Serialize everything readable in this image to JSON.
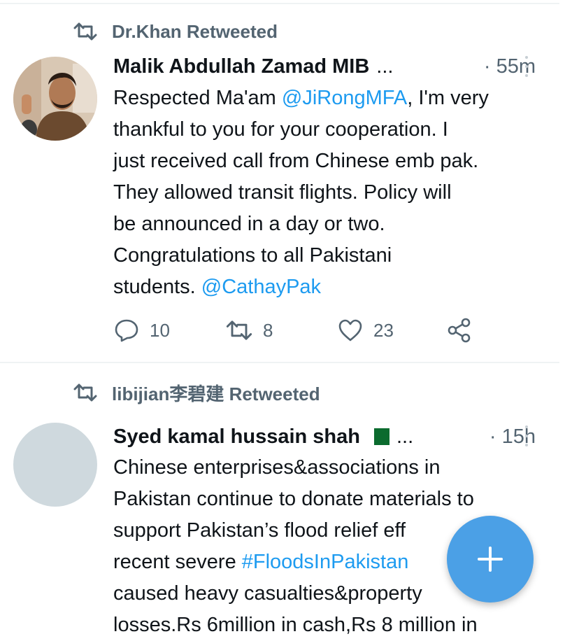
{
  "tweets": [
    {
      "retweeted_by": "Dr.Khan Retweeted",
      "author": "Malik Abdullah Zamad MIB",
      "ellipsis": "...",
      "time": "· 55m",
      "lines": [
        [
          "Respected Ma'am ",
          "@JiRongMFA",
          ", I'm very"
        ],
        [
          "thankful to you for your cooperation. I"
        ],
        [
          "just received call from Chinese emb pak."
        ],
        [
          "They allowed transit flights. Policy will"
        ],
        [
          "be announced in a day or two."
        ],
        [
          "Congratulations to all Pakistani"
        ],
        [
          "students.  ",
          "@CathayPak"
        ]
      ],
      "replies": "10",
      "retweets": "8",
      "likes": "23"
    },
    {
      "retweeted_by": "libijian李碧建 Retweeted",
      "author": "Syed kamal hussain shah",
      "ellipsis": "...",
      "time": "· 15h",
      "lines": [
        [
          "Chinese enterprises&associations in"
        ],
        [
          "Pakistan continue to donate materials to"
        ],
        [
          "support Pakistan’s flood relief eff",
          "",
          "s"
        ],
        [
          "recent severe ",
          "#FloodsInPakistan"
        ],
        [
          "caused heavy casualties&property"
        ],
        [
          "losses.Rs 6million in cash,Rs 8 million in"
        ]
      ]
    }
  ],
  "icons": {
    "retweet": "retweet-icon",
    "reply": "reply-icon",
    "like": "heart-icon",
    "share": "share-icon",
    "compose": "plus-icon"
  },
  "colors": {
    "accent": "#1d9bf0",
    "fab": "#4ba0e6",
    "muted": "#536471"
  }
}
